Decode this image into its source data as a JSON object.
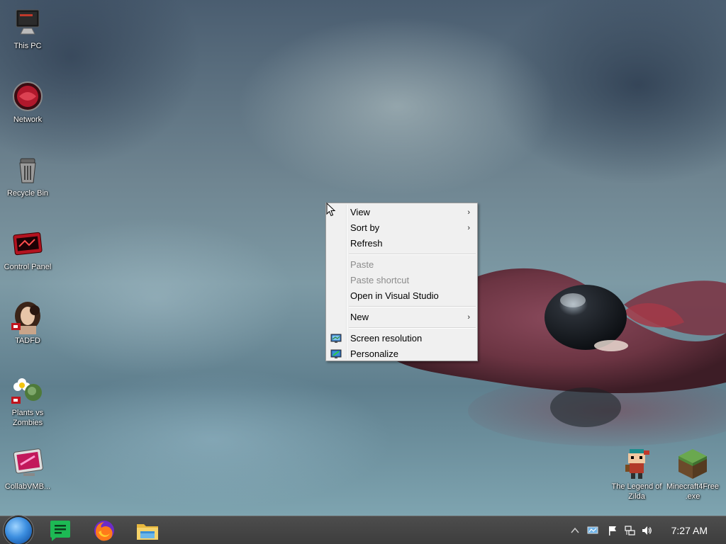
{
  "desktop": {
    "icons": [
      {
        "label": "This PC"
      },
      {
        "label": "Network"
      },
      {
        "label": "Recycle Bin"
      },
      {
        "label": "Control Panel"
      },
      {
        "label": "TADFD"
      },
      {
        "label": "Plants vs Zombies"
      },
      {
        "label": "CollabVMB..."
      },
      {
        "label": "The Legend of Zilda"
      },
      {
        "label": "Minecraft4Free .exe"
      }
    ]
  },
  "context_menu": {
    "items": [
      {
        "label": "View",
        "submenu": true,
        "enabled": true
      },
      {
        "label": "Sort by",
        "submenu": true,
        "enabled": true
      },
      {
        "label": "Refresh",
        "submenu": false,
        "enabled": true
      },
      {
        "label": "Paste",
        "submenu": false,
        "enabled": false
      },
      {
        "label": "Paste shortcut",
        "submenu": false,
        "enabled": false
      },
      {
        "label": "Open in Visual Studio",
        "submenu": false,
        "enabled": true
      },
      {
        "label": "New",
        "submenu": true,
        "enabled": true
      },
      {
        "label": "Screen resolution",
        "submenu": false,
        "enabled": true,
        "icon": "monitor-icon"
      },
      {
        "label": "Personalize",
        "submenu": false,
        "enabled": true,
        "icon": "personalize-icon"
      }
    ],
    "submenu_arrow": "›"
  },
  "taskbar": {
    "start_icon": "start-orb-icon",
    "pinned": [
      "notes-app-icon",
      "firefox-icon",
      "file-explorer-icon"
    ],
    "tray": [
      "show-hidden-icons-chevron",
      "network-tray-icon",
      "action-center-flag-icon",
      "network-icon",
      "volume-icon"
    ],
    "clock": "7:27 AM"
  },
  "colors": {
    "taskbar": "#3d3d3d",
    "menu_bg": "#f0f0f0",
    "menu_disabled": "#8c8c8c"
  }
}
